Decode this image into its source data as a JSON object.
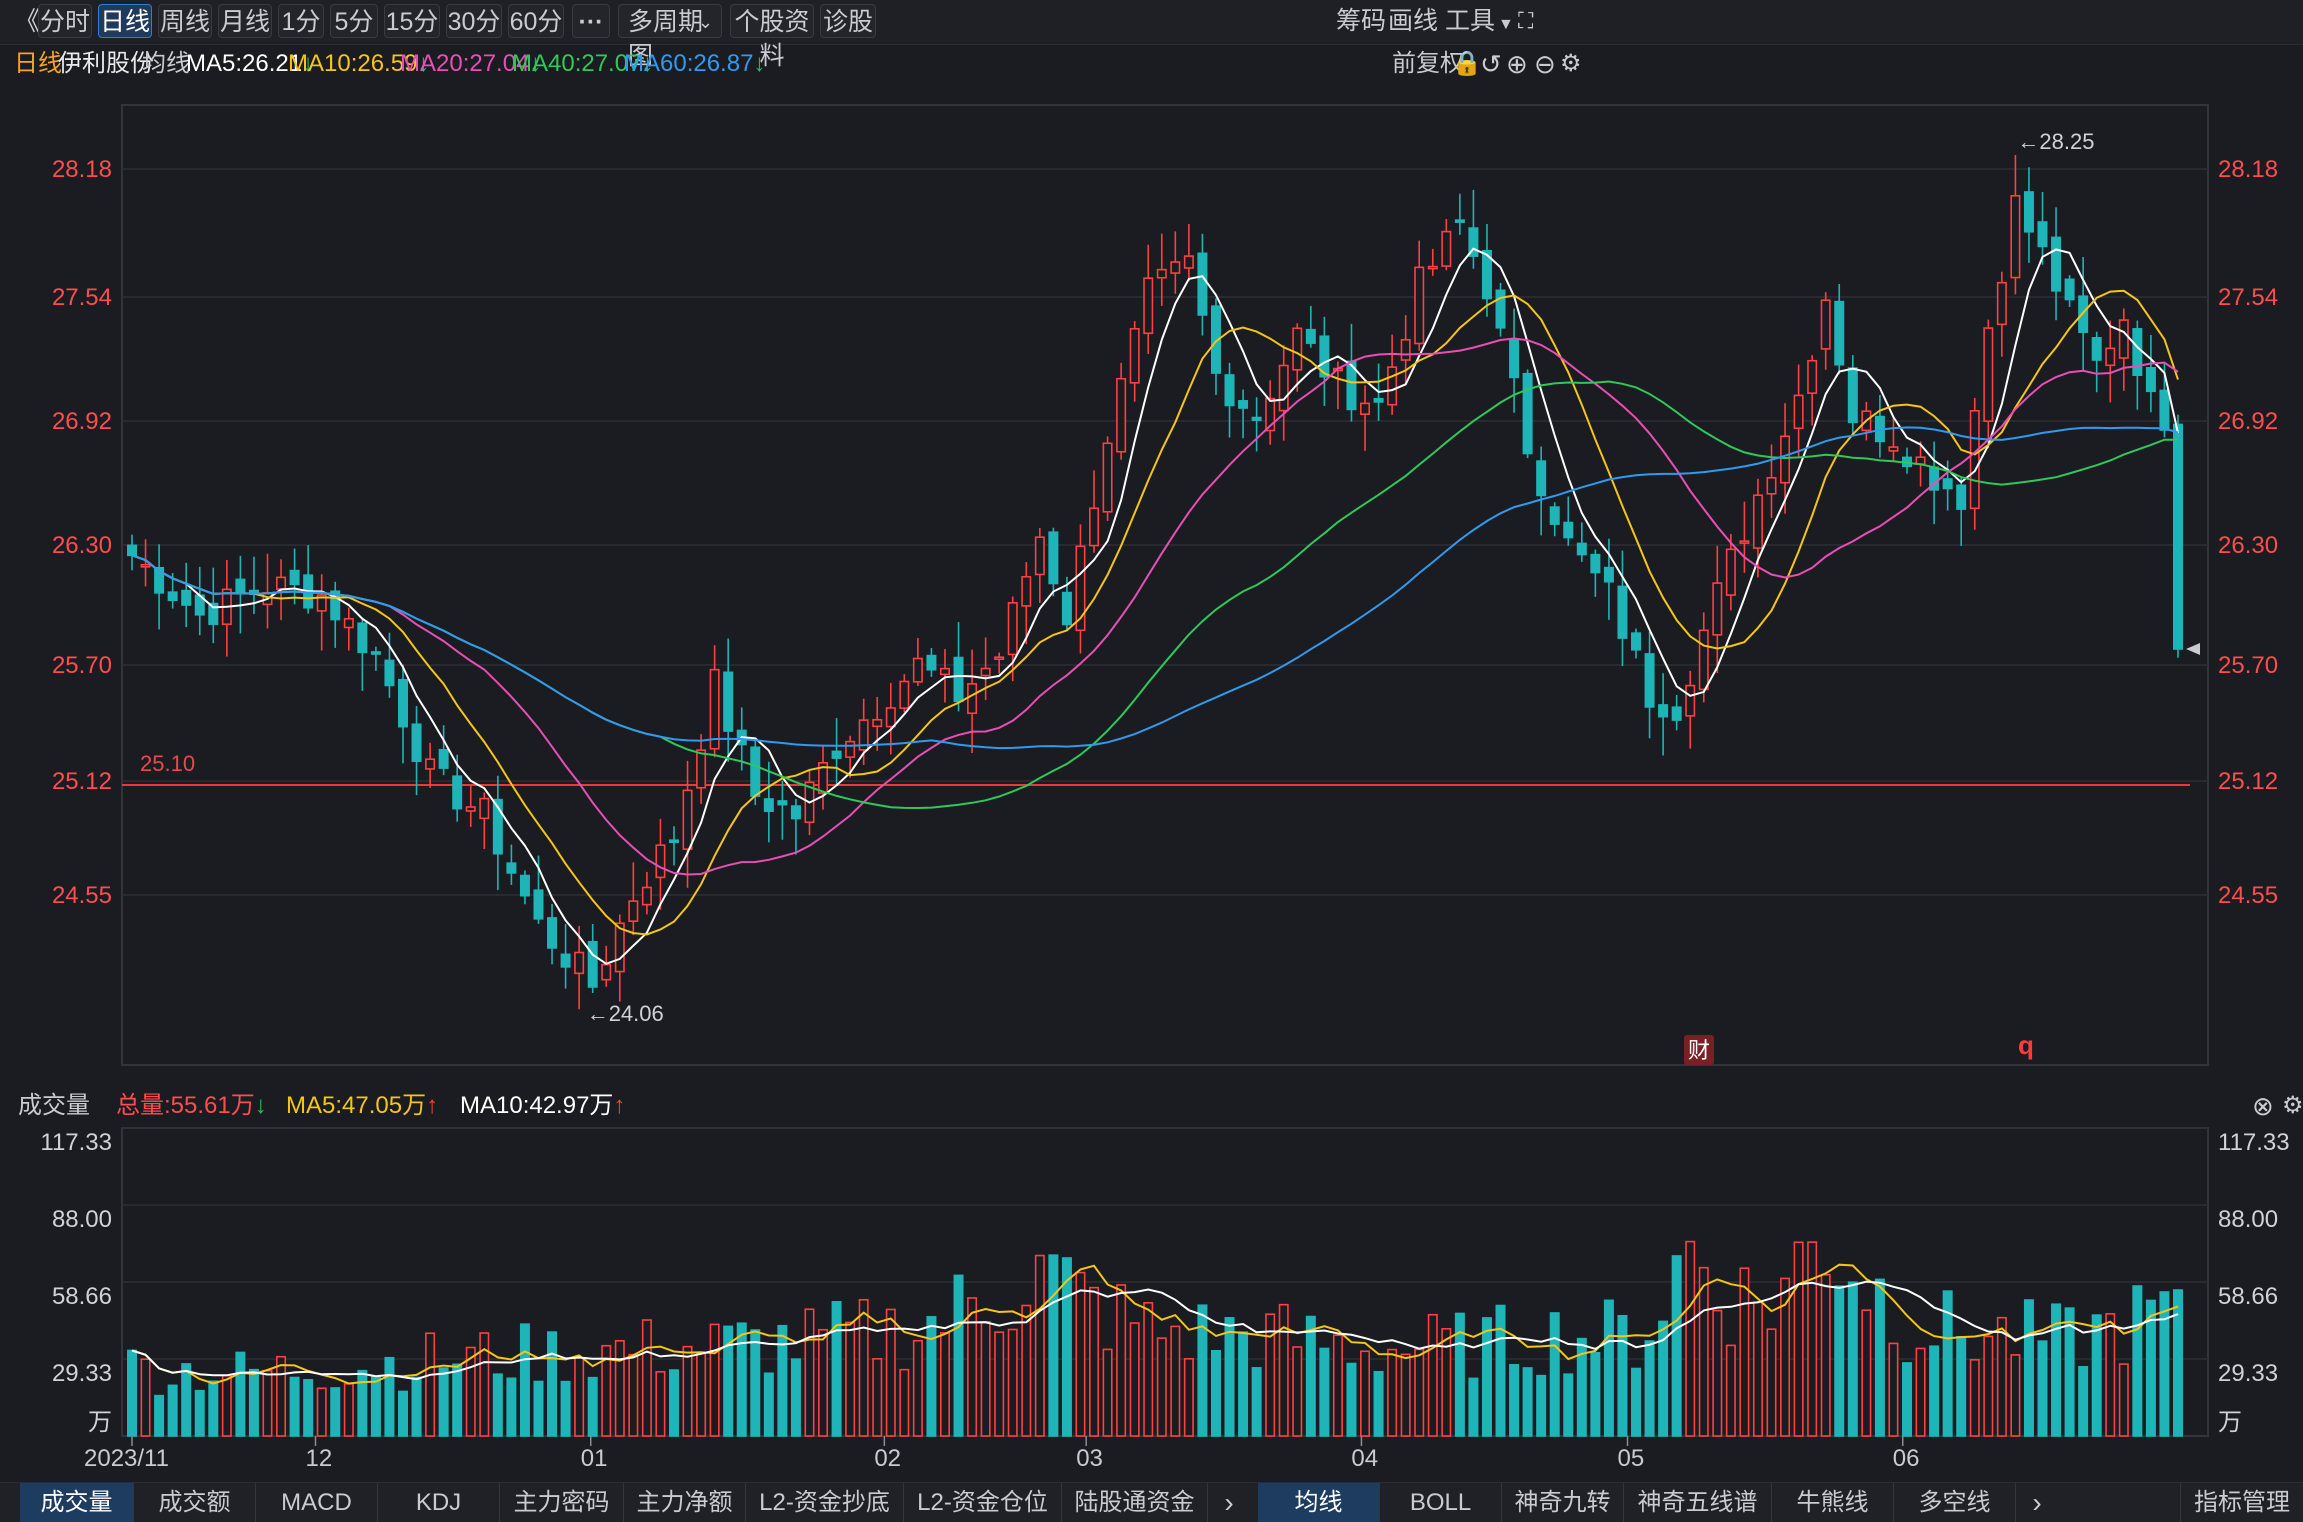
{
  "toolbar": {
    "back_label": "《",
    "periods": [
      "分时",
      "日线",
      "周线",
      "月线",
      "1分",
      "5分",
      "15分",
      "30分",
      "60分"
    ],
    "active_period": "日线",
    "more_label": "···",
    "multi_chart_label": "多周期图",
    "stock_info_label": "个股资料",
    "diagnose_label": "诊股",
    "right_items": [
      "筹码",
      "画线",
      "工具"
    ],
    "fullscreen_icon": "fullscreen-icon"
  },
  "ma_bar": {
    "period_label": "日线",
    "stock_name": "伊利股份",
    "ma_title": "均线",
    "ma5": "MA5:26.21",
    "ma10": "MA10:26.59",
    "ma20": "MA20:27.04",
    "ma40": "MA40:27.07",
    "ma60": "MA60:26.87",
    "adjust_label": "前复权",
    "colors": {
      "ma5": "#ffffff",
      "ma10": "#f5c518",
      "ma20": "#e84fb5",
      "ma40": "#2fc85a",
      "ma60": "#2f9bf0",
      "down_arrow": "#22c55e",
      "up_arrow": "#ff3b3b"
    }
  },
  "price_axis": {
    "ticks": [
      "28.18",
      "27.54",
      "26.92",
      "26.30",
      "25.70",
      "25.12",
      "24.55"
    ],
    "high_label": "←28.25",
    "low_label": "←24.06",
    "line_label": "25.10",
    "cai_badge": "财",
    "q_badge": "q"
  },
  "volume_bar": {
    "title": "成交量",
    "total": "总量:55.61万",
    "ma5": "MA5:47.05万",
    "ma10": "MA10:42.97万",
    "ticks": [
      "117.33",
      "88.00",
      "58.66",
      "29.33",
      "万"
    ]
  },
  "date_axis": {
    "labels": [
      "2023/11",
      "12",
      "01",
      "02",
      "03",
      "04",
      "05",
      "06"
    ]
  },
  "bottom_tabs_left": [
    "成交量",
    "成交额",
    "MACD",
    "KDJ",
    "主力密码",
    "主力净额",
    "L2-资金抄底",
    "L2-资金仓位",
    "陆股通资金"
  ],
  "bottom_tabs_right": [
    "均线",
    "BOLL",
    "神奇九转",
    "神奇五线谱",
    "牛熊线",
    "多空线"
  ],
  "bottom_manage": "指标管理",
  "chart_data": {
    "type": "candlestick",
    "title": "伊利股份 日线",
    "ylim": [
      23.7,
      28.5
    ],
    "volume_ylim": [
      0,
      117.33
    ],
    "hline": 25.1,
    "n_days": 152,
    "month_start_index": {
      "2023/11": 0,
      "12": 20,
      "01": 50,
      "02": 82,
      "03": 104,
      "04": 134,
      "05": 163,
      "06": 193
    },
    "anchors": [
      [
        0,
        26.25
      ],
      [
        5,
        25.95
      ],
      [
        10,
        26.1
      ],
      [
        14,
        26.05
      ],
      [
        18,
        25.75
      ],
      [
        22,
        25.15
      ],
      [
        26,
        24.95
      ],
      [
        30,
        24.4
      ],
      [
        34,
        24.1
      ],
      [
        37,
        24.55
      ],
      [
        40,
        24.85
      ],
      [
        43,
        25.6
      ],
      [
        46,
        25.05
      ],
      [
        49,
        24.95
      ],
      [
        52,
        25.3
      ],
      [
        55,
        25.5
      ],
      [
        58,
        25.7
      ],
      [
        61,
        25.55
      ],
      [
        64,
        25.75
      ],
      [
        67,
        26.35
      ],
      [
        69,
        25.95
      ],
      [
        72,
        26.85
      ],
      [
        75,
        27.55
      ],
      [
        78,
        27.7
      ],
      [
        80,
        27.15
      ],
      [
        83,
        26.95
      ],
      [
        86,
        27.35
      ],
      [
        89,
        27.1
      ],
      [
        92,
        27.0
      ],
      [
        95,
        27.6
      ],
      [
        98,
        27.9
      ],
      [
        100,
        27.6
      ],
      [
        103,
        26.8
      ],
      [
        106,
        26.3
      ],
      [
        109,
        26.05
      ],
      [
        112,
        25.55
      ],
      [
        114,
        25.5
      ],
      [
        117,
        26.05
      ],
      [
        120,
        26.55
      ],
      [
        123,
        27.05
      ],
      [
        125,
        27.55
      ],
      [
        127,
        26.95
      ],
      [
        130,
        26.85
      ],
      [
        133,
        26.65
      ],
      [
        135,
        26.55
      ],
      [
        137,
        27.4
      ],
      [
        139,
        28.0
      ],
      [
        141,
        27.75
      ],
      [
        143,
        27.45
      ],
      [
        145,
        27.2
      ],
      [
        147,
        27.45
      ],
      [
        149,
        27.0
      ],
      [
        151,
        26.9
      ]
    ],
    "close_path": "last",
    "last_close": 25.78,
    "volume_anchors": [
      [
        0,
        26
      ],
      [
        10,
        24
      ],
      [
        20,
        27
      ],
      [
        30,
        30
      ],
      [
        40,
        32
      ],
      [
        50,
        34
      ],
      [
        60,
        36
      ],
      [
        70,
        42
      ],
      [
        80,
        62
      ],
      [
        85,
        48
      ],
      [
        90,
        40
      ],
      [
        100,
        38
      ],
      [
        110,
        33
      ],
      [
        118,
        35
      ],
      [
        125,
        38
      ],
      [
        133,
        38
      ],
      [
        137,
        72
      ],
      [
        140,
        55
      ],
      [
        144,
        50
      ],
      [
        149,
        78
      ],
      [
        152,
        62
      ],
      [
        156,
        45
      ],
      [
        160,
        40
      ],
      [
        165,
        38
      ],
      [
        170,
        36
      ],
      [
        175,
        42
      ],
      [
        180,
        48
      ]
    ],
    "last_volume": 55.61,
    "ma_values_last": {
      "MA5": 26.21,
      "MA10": 26.59,
      "MA20": 27.04,
      "MA40": 27.07,
      "MA60": 26.87
    },
    "volume_ma_last": {
      "MA5": 47.05,
      "MA10": 42.97
    }
  }
}
